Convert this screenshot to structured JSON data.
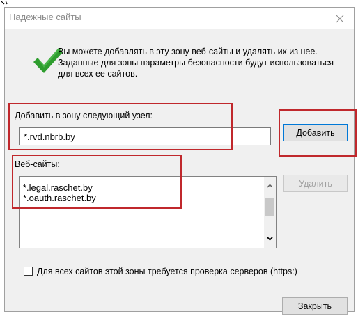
{
  "dialog": {
    "title": "Надежные сайты",
    "close_glyph": "✕",
    "description": "Вы можете добавлять в эту зону  веб-сайты и удалять их из нее. Заданные для зоны параметры безопасности будут использоваться для всех ее сайтов.",
    "add_label": "Добавить в зону следующий узел:",
    "add_value": "*.rvd.nbrb.by",
    "add_button": "Добавить",
    "sites_label": "Веб-сайты:",
    "sites": [
      "*.legal.raschet.by",
      "*.oauth.raschet.by"
    ],
    "remove_button": "Удалить",
    "https_checkbox_label": "Для всех сайтов этой зоны требуется проверка серверов (https:)",
    "https_checked": false,
    "close_button": "Закрыть"
  },
  "icons": {
    "checkmark": "checkmark-icon",
    "close": "close-icon",
    "scroll_up": "chevron-up-icon",
    "scroll_down": "chevron-down-icon"
  },
  "colors": {
    "highlight": "#c0282c",
    "checkmark": "#2e9d2e",
    "focus_border": "#0078d7"
  }
}
